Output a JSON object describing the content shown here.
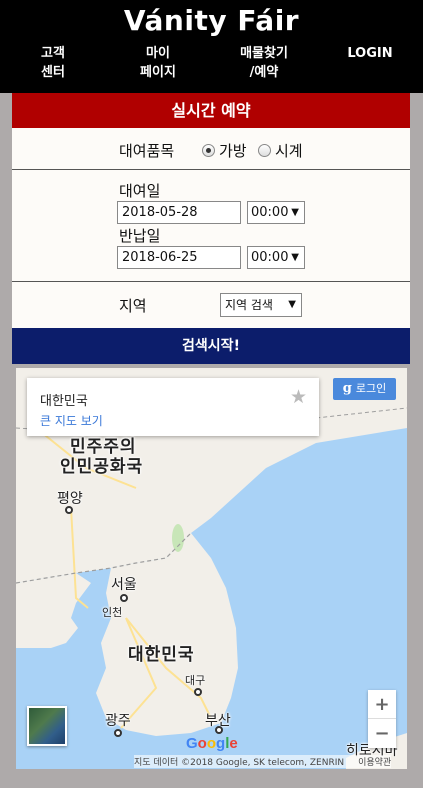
{
  "header": {
    "brand": "Vánity Fáir",
    "nav": [
      {
        "line1": "고객",
        "line2": "센터"
      },
      {
        "line1": "마이",
        "line2": "페이지"
      },
      {
        "line1": "매물찾기",
        "line2": "/예약"
      },
      {
        "line1": "LOGIN",
        "line2": ""
      }
    ]
  },
  "reservation": {
    "title": "실시간 예약",
    "category_label": "대여품목",
    "category_options": [
      {
        "label": "가방",
        "checked": true
      },
      {
        "label": "시계",
        "checked": false
      }
    ],
    "rent_label": "대여일",
    "rent_date": "2018-05-28",
    "rent_time": "00:00",
    "return_label": "반납일",
    "return_date": "2018-06-25",
    "return_time": "00:00",
    "region_label": "지역",
    "region_select": "지역 검색",
    "search_button": "검색시작!"
  },
  "map": {
    "info_title": "대한민국",
    "info_link": "큰 지도 보기",
    "login_button": "로그인",
    "labels": {
      "nk_line1": "민주주의",
      "nk_line2": "인민공화국",
      "pyongyang": "평양",
      "seoul": "서울",
      "incheon": "인천",
      "korea": "대한민국",
      "daegu": "대구",
      "gwangju": "광주",
      "busan": "부산",
      "hiroshima": "히로시마"
    },
    "google_logo": "Google",
    "attribution": "지도 데이터 ©2018 Google, SK telecom, ZENRIN",
    "terms": "이용약관",
    "colors": {
      "water": "#a9d2f6",
      "land": "#f2efe9",
      "border": "#9e9e9e",
      "road": "#fde293"
    }
  }
}
